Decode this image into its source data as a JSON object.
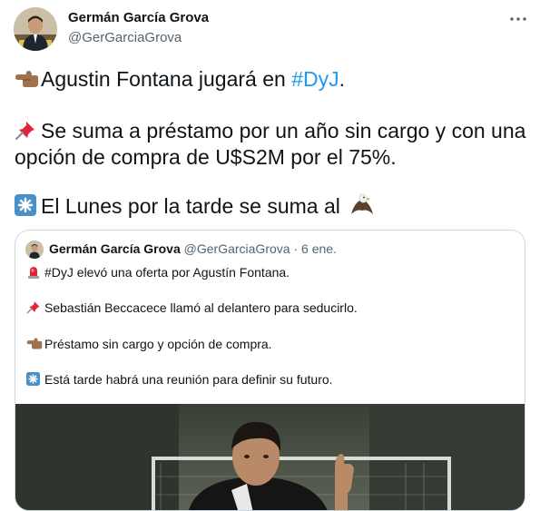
{
  "author": {
    "name": "Germán García Grova",
    "handle": "@GerGarciaGrova"
  },
  "tweet": {
    "line1_text": "Agustin Fontana jugará en ",
    "line1_hashtag": "#DyJ",
    "line1_end": ".",
    "line2": "Se suma a préstamo por un año sin cargo y con una",
    "line3": "opción de compra de U$S2M por el 75%.",
    "line4": "El Lunes por la tarde se suma al",
    "emojis": [
      "backhand-index-pointing-left",
      "pushpin",
      "eight-spoked-asterisk",
      "eagle"
    ]
  },
  "quoted": {
    "name": "Germán García Grova",
    "handle": "@GerGarciaGrova",
    "separator": "·",
    "date": "6 ene.",
    "lines": [
      "#DyJ elevó una oferta por Agustín Fontana.",
      "Sebastián Beccacece llamó al delantero para seducirlo.",
      "Préstamo sin cargo y opción de compra.",
      "Está tarde habrá una reunión para definir su futuro."
    ],
    "emojis": [
      "police-car-light",
      "pushpin",
      "backhand-index-pointing-left",
      "eight-spoked-asterisk"
    ]
  },
  "colors": {
    "link": "#1d9bf0",
    "secondary_text": "#536471",
    "border": "#cfd9de"
  },
  "more_icon": "more-horizontal-icon"
}
